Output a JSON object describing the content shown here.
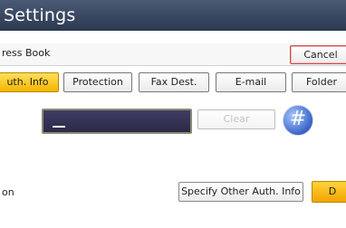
{
  "window": {
    "title": "Settings"
  },
  "header": {
    "subtitle": "ress Book",
    "cancel_label": "Cancel"
  },
  "tabs": [
    {
      "label": "uth. Info",
      "active": true
    },
    {
      "label": "Protection",
      "active": false
    },
    {
      "label": "Fax Dest.",
      "active": false
    },
    {
      "label": "E-mail",
      "active": false
    },
    {
      "label": "Folder",
      "active": false
    }
  ],
  "entry": {
    "value": "",
    "clear_label": "Clear",
    "hash_label": "#"
  },
  "row": {
    "label": "on",
    "specify_label": "Specify Other Auth. Info",
    "orange_label": "D"
  },
  "colors": {
    "title_bar": "#2b3950",
    "active_tab": "#f4b400",
    "entry_box": "#2b2a48",
    "hash_button": "#3a64c8",
    "cancel_border": "#d04a4a"
  }
}
